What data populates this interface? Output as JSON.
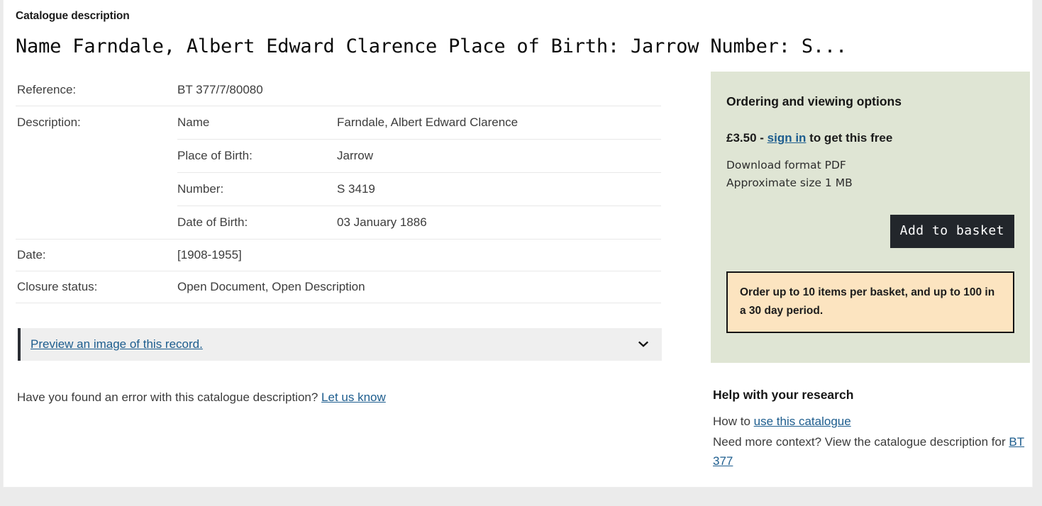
{
  "page": {
    "eyebrow": "Catalogue description",
    "record_title": "Name Farndale, Albert Edward Clarence Place of Birth: Jarrow Number: S..."
  },
  "details": {
    "reference": {
      "label": "Reference:",
      "value": "BT 377/7/80080"
    },
    "description": {
      "label": "Description:",
      "rows": [
        {
          "key": "Name",
          "value": "Farndale, Albert Edward Clarence"
        },
        {
          "key": "Place of Birth:",
          "value": "Jarrow"
        },
        {
          "key": "Number:",
          "value": "S 3419"
        },
        {
          "key": "Date of Birth:",
          "value": "03 January 1886"
        }
      ]
    },
    "date": {
      "label": "Date:",
      "value": "[1908-1955]"
    },
    "closure": {
      "label": "Closure status:",
      "value": "Open Document, Open Description"
    }
  },
  "accordion": {
    "link_label": "Preview an image of this record.",
    "icon": "chevron-down-icon"
  },
  "feedback": {
    "text": "Have you found an error with this catalogue description?",
    "link_label": "Let us know"
  },
  "sidebar": {
    "order": {
      "title": "Ordering and viewing options",
      "price": "£3.50 - ",
      "sign_in_label": "sign in",
      "price_suffix": " to get this free",
      "download_format": "Download format PDF",
      "approximate_size": "Approximate size 1 MB",
      "basket_button": "Add to basket",
      "notice": "Order up to 10 items per basket, and up to 100 in a 30 day period."
    },
    "help": {
      "title": "Help with your research",
      "how_to_prefix": "How to ",
      "how_to_link": "use this catalogue",
      "context_prefix": "Need more context? View the catalogue description for ",
      "context_link": "BT 377"
    }
  },
  "colors": {
    "order_box_bg": "#dfe5d4",
    "notice_bg": "#fce4c0",
    "notice_border": "#141414",
    "button_bg": "#22262b",
    "link": "#1d5d8e",
    "accordion_bg": "#efefef",
    "accordion_accent": "#2a2d33",
    "page_bg": "#ebebeb"
  }
}
